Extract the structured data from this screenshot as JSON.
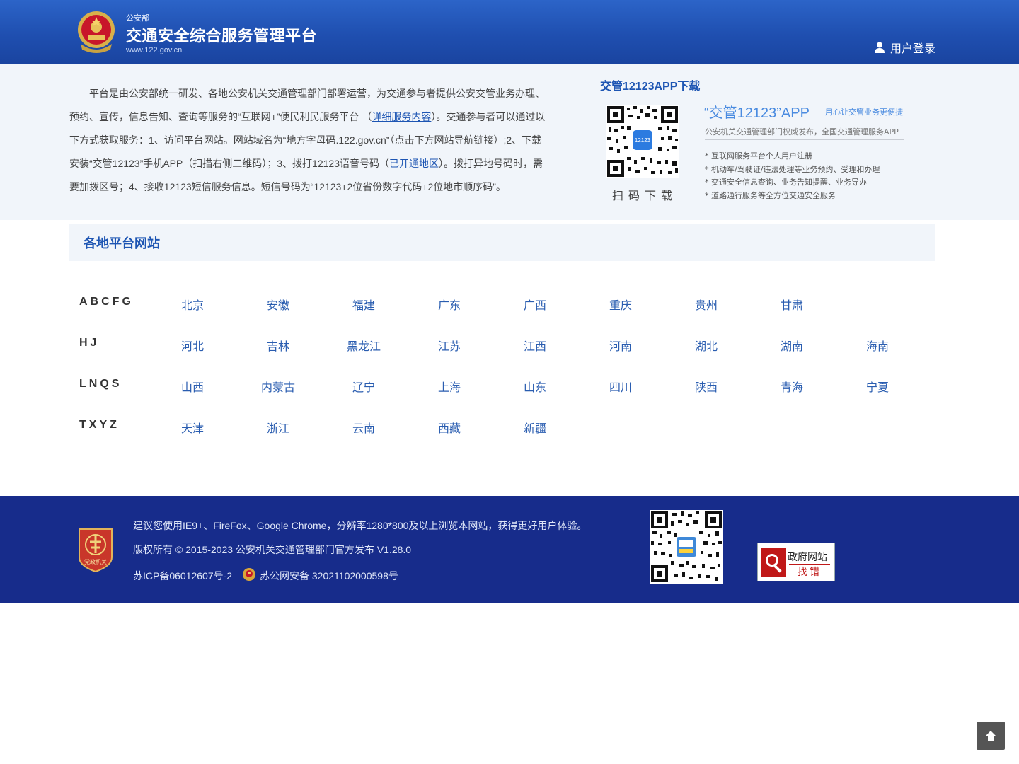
{
  "header": {
    "org": "公安部",
    "title": "交通安全综合服务管理平台",
    "url": "www.122.gov.cn",
    "login_label": "用户登录",
    "emblem_icon": "police-emblem-icon",
    "user_icon": "user-icon"
  },
  "intro": {
    "part1": "平台是由公安部统一研发、各地公安机关交通管理部门部署运营，为交通参与者提供公安交管业务办理、预约、宣传，信息告知、查询等服务的“互联网+”便民利民服务平台 （",
    "link1": "详细服务内容",
    "part2": "）。交通参与者可以通过以下方式获取服务：1、访问平台网站。网站域名为“地方字母码.122.gov.cn”（点击下方网站导航链接）;2、下载安装“交管12123”手机APP（扫描右侧二维码）；3、拨打12123语音号码（",
    "link2": "已开通地区",
    "part3": "）。拨打异地号码时，需要加拨区号；4、接收12123短信服务信息。短信号码为“12123+2位省份数字代码+2位地市顺序码”。"
  },
  "app": {
    "title": "交管12123APP下载",
    "scan_label": "扫码下载",
    "name": "“交管12123”APP",
    "slogan": "用心让交管业务更便捷",
    "sub": "公安机关交通管理部门权威发布，全国交通管理服务APP",
    "features": [
      "互联网服务平台个人用户注册",
      "机动车/驾驶证/违法处理等业务预约、受理和办理",
      "交通安全信息查询、业务告知提醒、业务导办",
      "道路通行服务等全方位交通安全服务"
    ]
  },
  "platforms": {
    "title": "各地平台网站",
    "rows": [
      {
        "letters": "ABCFG",
        "regions": [
          "北京",
          "安徽",
          "福建",
          "广东",
          "广西",
          "重庆",
          "贵州",
          "甘肃"
        ]
      },
      {
        "letters": "HJ",
        "regions": [
          "河北",
          "吉林",
          "黑龙江",
          "江苏",
          "江西",
          "河南",
          "湖北",
          "湖南",
          "海南"
        ]
      },
      {
        "letters": "LNQS",
        "regions": [
          "山西",
          "内蒙古",
          "辽宁",
          "上海",
          "山东",
          "四川",
          "陕西",
          "青海",
          "宁夏"
        ]
      },
      {
        "letters": "TXYZ",
        "regions": [
          "天津",
          "浙江",
          "云南",
          "西藏",
          "新疆"
        ]
      }
    ]
  },
  "footer": {
    "browser_tip": "建议您使用IE9+、FireFox、Google Chrome，分辨率1280*800及以上浏览本网站，获得更好用户体验。",
    "copyright": "版权所有 © 2015-2023 公安机关交通管理部门官方发布 V1.28.0",
    "icp": "苏ICP备06012607号-2",
    "police_record": "苏公网安备 32021102000598号",
    "party_badge_text": "党政机关",
    "gov_badge_line1": "政府网站",
    "gov_badge_line2": "找错"
  },
  "colors": {
    "header_blue": "#1f4fb0",
    "link_blue": "#2a5db0",
    "footer_navy": "#172c8b"
  }
}
